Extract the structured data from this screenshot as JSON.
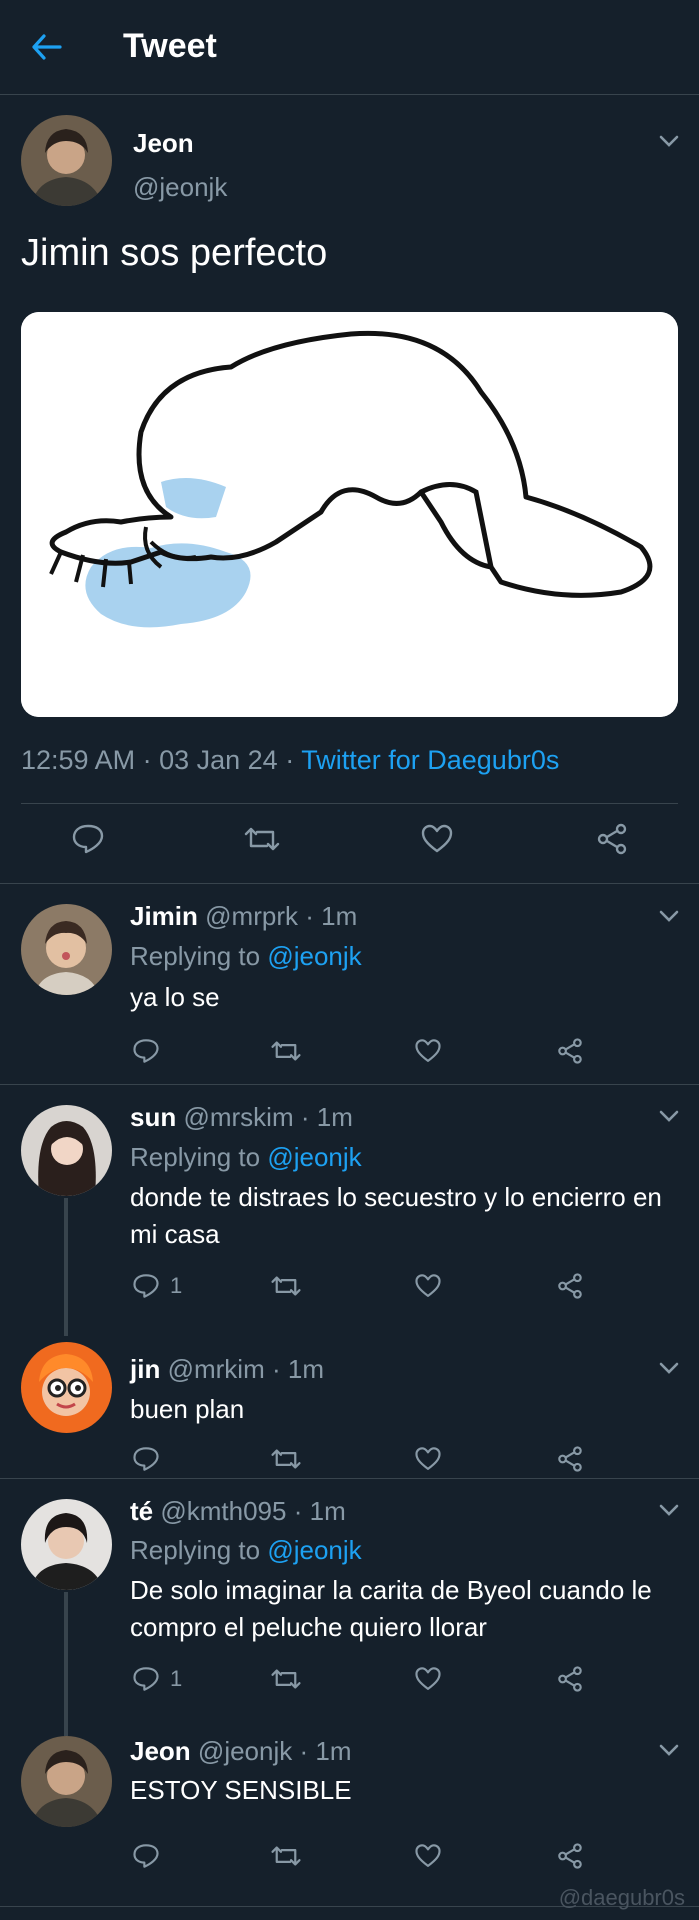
{
  "header": {
    "title": "Tweet",
    "back_icon": "arrow-left-icon",
    "accent": "#1da1f2"
  },
  "main_tweet": {
    "name": "Jeon",
    "handle": "@jeonjk",
    "text": "Jimin sos perfecto",
    "time": "12:59 AM",
    "date": "03 Jan 24",
    "source": "Twitter for Daegubr0s"
  },
  "replies": [
    {
      "name": "Jimin",
      "handle": "@mrprk",
      "time": "1m",
      "replying_label": "Replying to",
      "replying_to": "@jeonjk",
      "text": "ya lo se",
      "reply_count": ""
    },
    {
      "name": "sun",
      "handle": "@mrskim",
      "time": "1m",
      "replying_label": "Replying to",
      "replying_to": "@jeonjk",
      "text": "donde te distraes lo secuestro y lo encierro en mi casa",
      "reply_count": "1"
    },
    {
      "name": "jin",
      "handle": "@mrkim",
      "time": "1m",
      "text": "buen plan",
      "reply_count": ""
    },
    {
      "name": "té",
      "handle": "@kmth095",
      "time": "1m",
      "replying_label": "Replying to",
      "replying_to": "@jeonjk",
      "text": "De solo imaginar la carita de Byeol cuando le compro el peluche quiero llorar",
      "reply_count": "1"
    },
    {
      "name": "Jeon",
      "handle": "@jeonjk",
      "time": "1m",
      "text": "ESTOY SENSIBLE",
      "reply_count": ""
    }
  ],
  "watermark": "@daegubr0s",
  "colors": {
    "background": "#15202b",
    "border": "#38444d",
    "secondary_text": "#8899a6",
    "link": "#1da1f2"
  }
}
